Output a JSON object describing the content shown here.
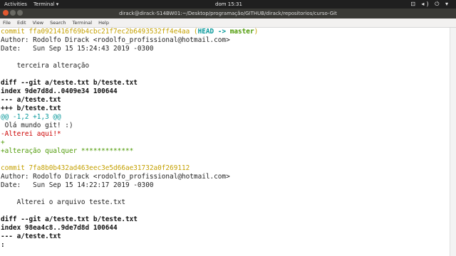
{
  "topbar": {
    "activities": "Activities",
    "app": "Terminal ▾",
    "clock": "dom 15:31",
    "tray": "⊡ ◂) ⏻ ▾"
  },
  "window": {
    "title": "dirack@dirack-S14BW01:~/Desktop/programação/GITHUB/dirack/repositorios/curso-Git"
  },
  "menu": [
    "File",
    "Edit",
    "View",
    "Search",
    "Terminal",
    "Help"
  ],
  "lines": {
    "c1_commit": "commit ffa0921416f69b4cbc21f7ec2b6493532ff4e4aa",
    "c1_refs_open": " (",
    "c1_head": "HEAD -> ",
    "c1_master": "master",
    "c1_refs_close": ")",
    "c1_author": "Author: Rodolfo Dirack <rodolfo_profissional@hotmail.com>",
    "c1_date": "Date:   Sun Sep 15 15:24:43 2019 -0300",
    "c1_msg": "    terceira alteração",
    "c1_diff": "diff --git a/teste.txt b/teste.txt",
    "c1_index": "index 9de7d8d..0409e34 100644",
    "c1_minus": "--- a/teste.txt",
    "c1_plus": "+++ b/teste.txt",
    "c1_hunk": "@@ -1,2 +1,3 @@",
    "c1_ctx": " Olá mundo git! :)",
    "c1_del": "-Alterei aqui!*",
    "c1_add1": "+",
    "c1_add2": "+alteração qualquer *************",
    "c2_commit": "commit 7fa8b0b432ad463eec3e5d66ae31732a0f269112",
    "c2_author": "Author: Rodolfo Dirack <rodolfo_profissional@hotmail.com>",
    "c2_date": "Date:   Sun Sep 15 14:22:17 2019 -0300",
    "c2_msg": "    Alterei o arquivo teste.txt",
    "c2_diff": "diff --git a/teste.txt b/teste.txt",
    "c2_index": "index 98ea4c8..9de7d8d 100644",
    "c2_minus": "--- a/teste.txt",
    "prompt": ":"
  }
}
